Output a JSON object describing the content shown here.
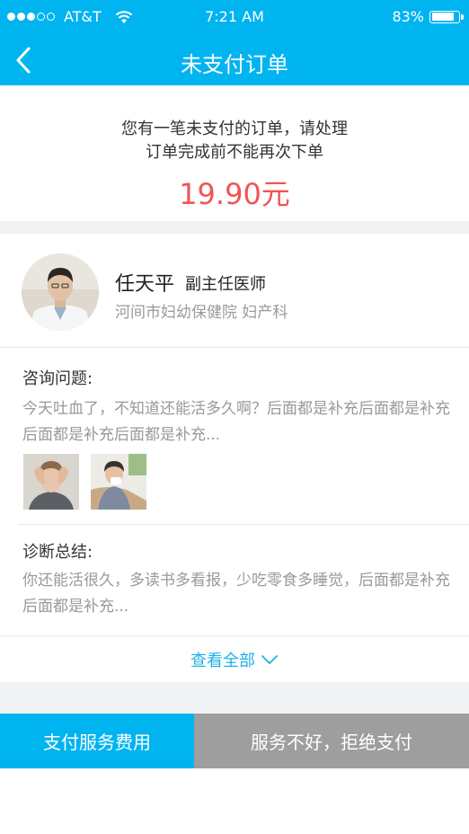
{
  "status_bar": {
    "carrier": "AT&T",
    "time": "7:21 AM",
    "battery": "83%",
    "battery_level": 0.83
  },
  "nav": {
    "title": "未支付订单",
    "back_icon": "chevron-left-icon"
  },
  "order": {
    "message_line1": "您有一笔未支付的订单，请处理",
    "message_line2": "订单完成前不能再次下单",
    "amount": "19.90元"
  },
  "doctor": {
    "name": "任天平",
    "title": "副主任医师",
    "hospital": "河间市妇幼保健院  妇产科"
  },
  "consultation": {
    "label": "咨询问题:",
    "question": "今天吐血了，不知道还能活多久啊？后面都是补充后面都是补充后面都是补充后面都是补充...",
    "images": [
      "headache-photo",
      "cold-photo"
    ]
  },
  "diagnosis": {
    "label": "诊断总结:",
    "summary": "你还能活很久，多读书多看报，少吃零食多睡觉，后面都是补充后面都是补充..."
  },
  "view_all": {
    "label": "查看全部",
    "icon": "chevron-down-icon"
  },
  "actions": {
    "pay_label": "支付服务费用",
    "refuse_label": "服务不好，拒绝支付"
  },
  "colors": {
    "brand": "#00b4f0",
    "price": "#f05555",
    "link": "#1fb1e6",
    "refuse": "#9e9e9e"
  }
}
